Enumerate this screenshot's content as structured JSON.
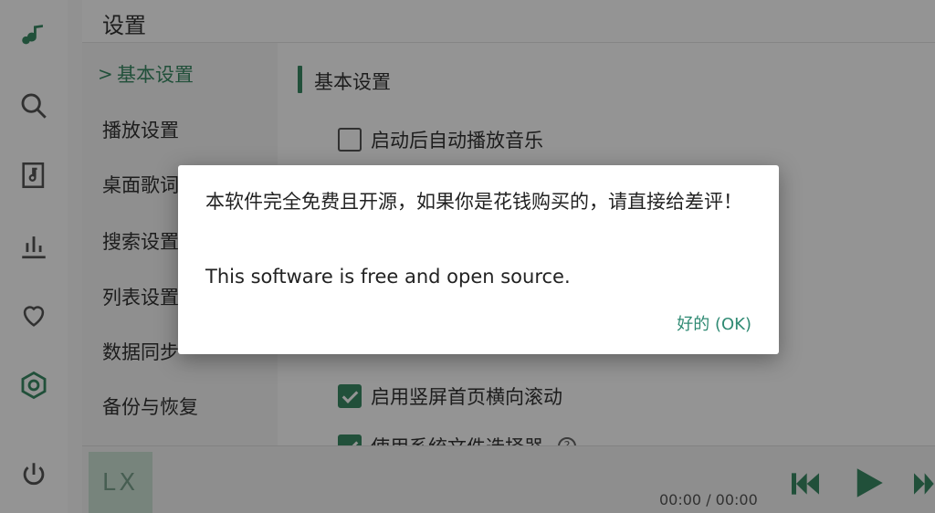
{
  "page": {
    "title": "设置"
  },
  "subnav": {
    "items": [
      {
        "label": "基本设置",
        "active": true
      },
      {
        "label": "播放设置"
      },
      {
        "label": "桌面歌词设置"
      },
      {
        "label": "搜索设置"
      },
      {
        "label": "列表设置"
      },
      {
        "label": "数据同步"
      },
      {
        "label": "备份与恢复"
      }
    ],
    "active_marker": ">"
  },
  "section": {
    "title": "基本设置",
    "options": [
      {
        "label": "启动后自动播放音乐",
        "checked": false
      },
      {
        "label": "启用竖屏首页横向滚动",
        "checked": true
      },
      {
        "label": "使用系统文件选择器",
        "checked": true,
        "help": "?"
      }
    ]
  },
  "player": {
    "album_placeholder": "LX",
    "time": "00:00 / 00:00"
  },
  "dialog": {
    "message_cn": "本软件完全免费且开源，如果你是花钱购买的，请直接给差评！",
    "message_en": "This software is free and open source.",
    "ok_label": "好的 (OK)"
  },
  "colors": {
    "accent": "#3a8a64",
    "dialog_button": "#2f8a73"
  },
  "icons": {
    "rail": [
      "music-logo-icon",
      "search-icon",
      "playlist-icon",
      "chart-icon",
      "heart-icon",
      "settings-icon",
      "power-icon"
    ],
    "player": [
      "prev-icon",
      "play-icon",
      "next-icon"
    ]
  }
}
